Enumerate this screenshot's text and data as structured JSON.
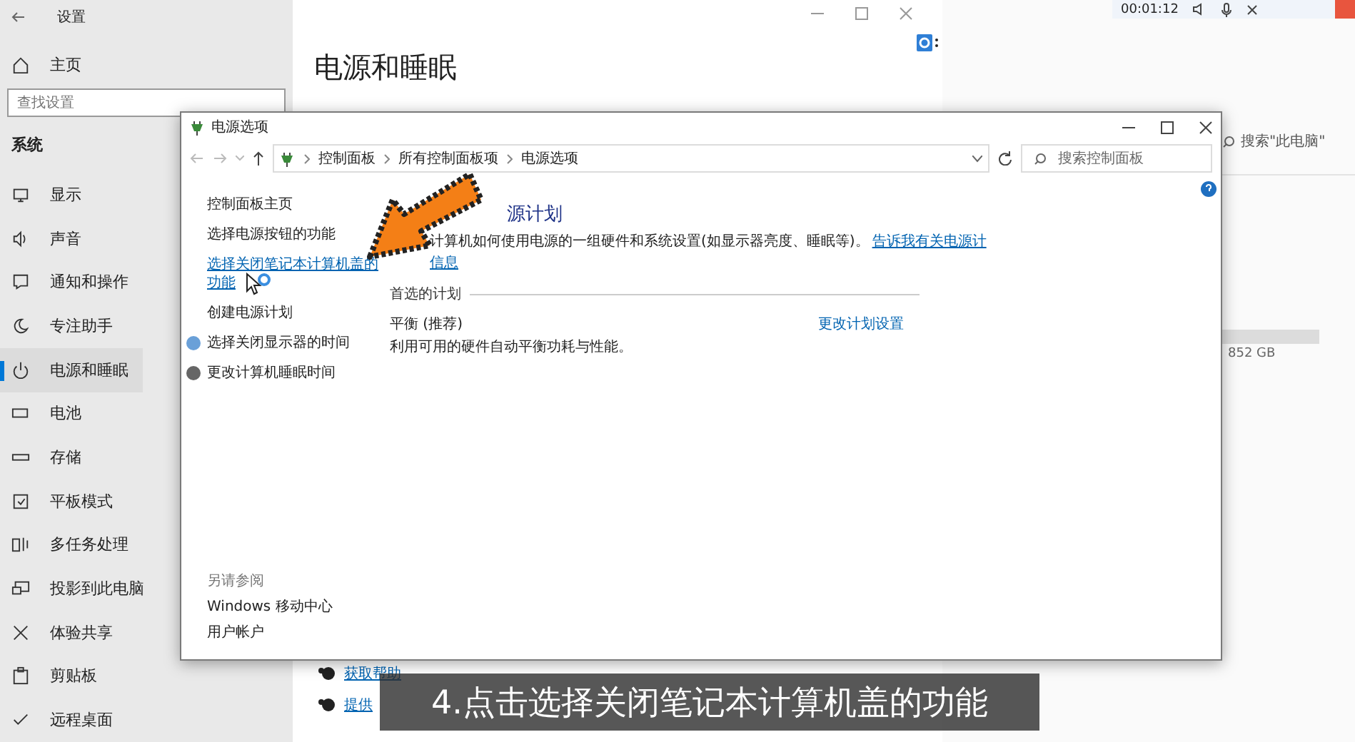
{
  "settings": {
    "title": "设置",
    "home": "主页",
    "search": {
      "placeholder": "查找设置"
    },
    "section": "系统",
    "items": [
      {
        "label": "显示",
        "selected": false
      },
      {
        "label": "声音",
        "selected": false
      },
      {
        "label": "通知和操作",
        "selected": false
      },
      {
        "label": "专注助手",
        "selected": false
      },
      {
        "label": "电源和睡眠",
        "selected": true
      },
      {
        "label": "电池",
        "selected": false
      },
      {
        "label": "存储",
        "selected": false
      },
      {
        "label": "平板模式",
        "selected": false
      },
      {
        "label": "多任务处理",
        "selected": false
      },
      {
        "label": "投影到此电脑",
        "selected": false
      },
      {
        "label": "体验共享",
        "selected": false
      },
      {
        "label": "剪贴板",
        "selected": false
      },
      {
        "label": "远程桌面",
        "selected": false
      }
    ],
    "page_title": "电源和睡眠",
    "help_links": [
      "获取帮助",
      "提供"
    ]
  },
  "explorer": {
    "search": {
      "placeholder": "搜索\"此电脑\""
    },
    "storage_text": "852 GB"
  },
  "recorder": {
    "time": "00:01:12"
  },
  "power_options": {
    "title": "电源选项",
    "breadcrumb": [
      "控制面板",
      "所有控制面板项",
      "电源选项"
    ],
    "search": {
      "placeholder": "搜索控制面板"
    },
    "tasks": [
      {
        "label": "控制面板主页",
        "kind": "text",
        "hovered": false
      },
      {
        "label": "选择电源按钮的功能",
        "kind": "text",
        "hovered": false
      },
      {
        "label": "选择关闭笔记本计算机盖的功能",
        "kind": "text",
        "hovered": true
      },
      {
        "label": "创建电源计划",
        "kind": "text",
        "hovered": false
      },
      {
        "label": "选择关闭显示器的时间",
        "kind": "icon",
        "hovered": false
      },
      {
        "label": "更改计算机睡眠时间",
        "kind": "icon",
        "hovered": false
      }
    ],
    "see_also_title": "另请参阅",
    "see_also": [
      "Windows 移动中心",
      "用户帐户"
    ],
    "heading": "源计划",
    "description": "计算机如何使用电源的一组硬件和系统设置(如显示器亮度、睡眠等)。",
    "info_link": [
      "告诉我有关电源计",
      "信息"
    ],
    "plans_header": "首选的计划",
    "plan": {
      "name": "平衡 (推荐)",
      "description": "利用可用的硬件自动平衡功耗与性能。",
      "settings_link": "更改计划设置"
    }
  },
  "caption": "4.点击选择关闭笔记本计算机盖的功能"
}
